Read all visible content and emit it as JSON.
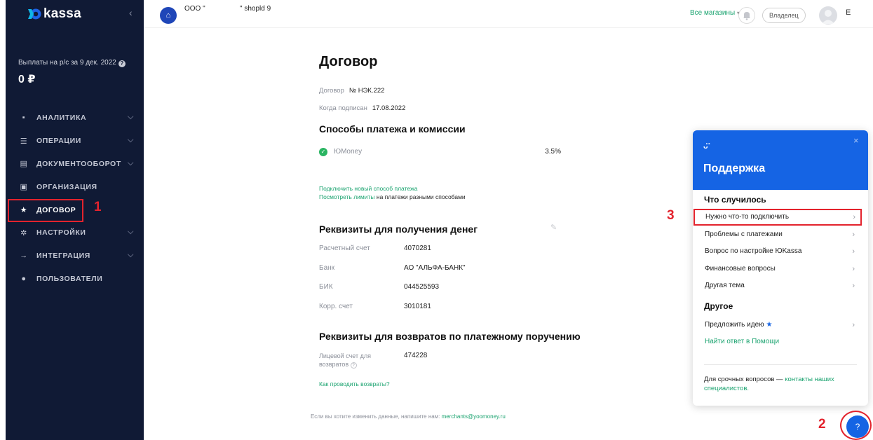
{
  "brand": {
    "name": "kassa",
    "accent": "#1aa36f",
    "sidebar_bg": "#101a35",
    "support_blue": "#1564e4",
    "annotation_red": "#e3232d"
  },
  "sidebar": {
    "collapse_icon": "chevron-left-icon",
    "payout_label": "Выплаты на р/с за 9 дек. 2022",
    "payout_value": "0 ₽",
    "items": [
      {
        "label": "АНАЛИТИКА",
        "icon": "bar-chart-icon",
        "glyph": "▪",
        "has_chevron": true
      },
      {
        "label": "ОПЕРАЦИИ",
        "icon": "list-icon",
        "glyph": "☰",
        "has_chevron": true
      },
      {
        "label": "ДОКУМЕНТООБОРОТ",
        "icon": "document-icon",
        "glyph": "▤",
        "has_chevron": true
      },
      {
        "label": "ОРГАНИЗАЦИЯ",
        "icon": "building-icon",
        "glyph": "▣",
        "has_chevron": false
      },
      {
        "label": "ДОГОВОР",
        "icon": "star-icon",
        "glyph": "★",
        "has_chevron": false,
        "active": true
      },
      {
        "label": "НАСТРОЙКИ",
        "icon": "gear-icon",
        "glyph": "✲",
        "has_chevron": true
      },
      {
        "label": "ИНТЕГРАЦИЯ",
        "icon": "arrow-right-icon",
        "glyph": "→",
        "has_chevron": true
      },
      {
        "label": "ПОЛЬЗОВАТЕЛИ",
        "icon": "user-icon",
        "glyph": "●",
        "has_chevron": false
      }
    ]
  },
  "annotations": {
    "one": "1",
    "two": "2",
    "three": "3"
  },
  "topbar": {
    "org_name": "ООО \"",
    "shop_id": "\" shopld 9",
    "all_shops": "Все магазины",
    "role": "Владелец",
    "user_initial": "E"
  },
  "contract": {
    "title": "Договор",
    "number_label": "Договор",
    "number_value": "№ НЭК.222",
    "signed_label": "Когда подписан",
    "signed_value": "17.08.2022",
    "methods_title": "Способы платежа и комиссии",
    "methods": [
      {
        "name": "ЮMoney",
        "fee": "3.5%"
      }
    ],
    "connect_link": "Подключить новый способ платежа",
    "limits_link": "Посмотреть лимиты",
    "limits_suffix": " на платежи разными способами"
  },
  "requisites": {
    "title": "Реквизиты для получения денег",
    "rows": [
      {
        "label": "Расчетный счет",
        "value": "4070281"
      },
      {
        "label": "Банк",
        "value": "АО \"АЛЬФА-БАНК\""
      },
      {
        "label": "БИК",
        "value": "044525593"
      },
      {
        "label": "Корр. счет",
        "value": "3010181"
      }
    ]
  },
  "refunds": {
    "title": "Реквизиты для возвратов по платежному поручению",
    "account_label_1": "Лицевой счет для",
    "account_label_2": "возвратов",
    "account_value": "474228",
    "howto_link": "Как проводить возвраты?"
  },
  "footer": {
    "note": "Если вы хотите изменить данные, напишите нам: ",
    "email": "merchants@yoomoney.ru"
  },
  "support": {
    "title": "Поддержка",
    "close": "×",
    "what_happened": "Что случилось",
    "items": [
      "Нужно что-то подключить",
      "Проблемы с платежами",
      "Вопрос по настройке ЮKassa",
      "Финансовые вопросы",
      "Другая тема"
    ],
    "other_title": "Другое",
    "suggest_idea": "Предложить идею",
    "find_answer": "Найти ответ в Помощи",
    "urgent_prefix": "Для срочных вопросов — ",
    "urgent_link": "контакты наших специалистов",
    "urgent_suffix": "."
  },
  "help_button": "?"
}
